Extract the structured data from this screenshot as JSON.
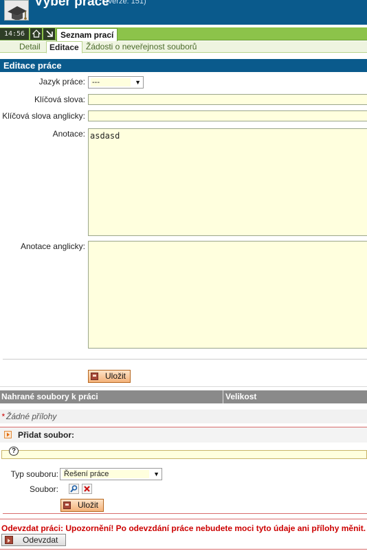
{
  "header": {
    "title": "Výběr práce",
    "version": "(verze: 151)"
  },
  "topbar": {
    "clock": "14:56",
    "home_icon": "home-icon",
    "collapse_icon": "arrow-icon",
    "active_tab": "Seznam prací"
  },
  "subtabs": {
    "items": [
      "Detail",
      "Editace",
      "Žádosti o neveřejnost souborů"
    ],
    "active": "Editace"
  },
  "edit": {
    "heading": "Editace práce",
    "language_label": "Jazyk práce:",
    "language_value": "---",
    "keywords_label": "Klíčová slova:",
    "keywords_value": "",
    "keywords_en_label": "Klíčová slova anglicky:",
    "keywords_en_value": "",
    "annotation_label": "Anotace:",
    "annotation_value": "asdasd",
    "annotation_en_label": "Anotace anglicky:",
    "annotation_en_value": "",
    "save_label": "Uložit"
  },
  "files": {
    "col_name": "Nahrané soubory k práci",
    "col_size": "Velikost",
    "required_mark": "*",
    "empty_text": "Žádné přílohy"
  },
  "add_file": {
    "heading": "Přidat soubor:",
    "help_icon": "question-icon",
    "type_label": "Typ souboru:",
    "type_value": "Řešení práce",
    "file_label": "Soubor:",
    "save_label": "Uložit"
  },
  "submit": {
    "warning": "Odevzdat práci: Upozornění! Po odevzdání práce nebudete moci tyto údaje ani přílohy měnit.",
    "button_label": "Odevzdat"
  },
  "colors": {
    "header_blue": "#0a5a8c",
    "tab_green": "#8cc34a",
    "field_yellow": "#ffffde",
    "warning_red": "#cc0000",
    "button_orange": "#f4b27a"
  }
}
